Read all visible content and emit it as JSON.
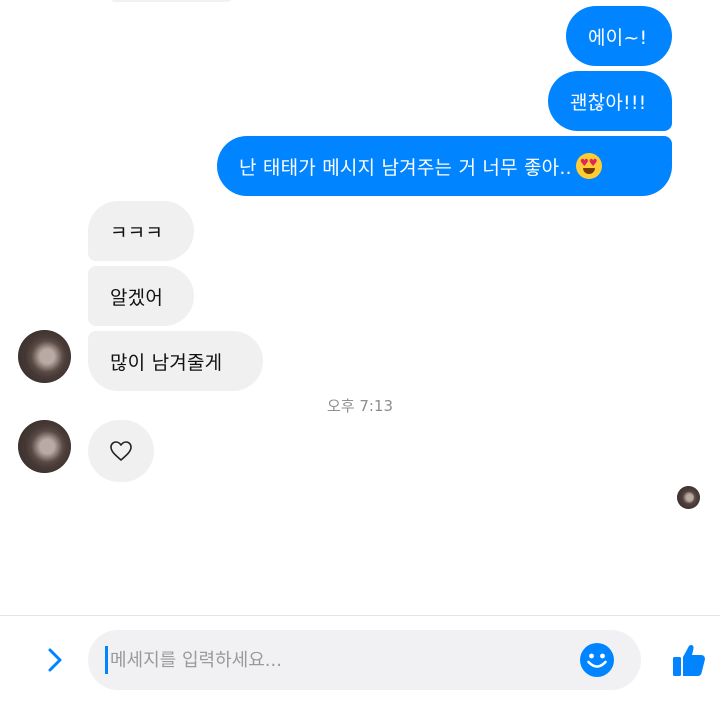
{
  "colors": {
    "accent": "#0084ff",
    "incoming_bubble": "#f1f0f0",
    "timestamp": "#8e8e93"
  },
  "messages": {
    "sent": [
      {
        "text": "에이~!"
      },
      {
        "text": "괜찮아!!!"
      },
      {
        "text": "난 태태가 메시지 남겨주는 거 너무 좋아..",
        "emoji": "heart-eyes-emoji"
      }
    ],
    "received": [
      {
        "text": "ㅋㅋㅋ"
      },
      {
        "text": "알겠어"
      },
      {
        "text": "많이 남겨줄게"
      }
    ],
    "timestamp": "오후 7:13",
    "reaction": "♡"
  },
  "composer": {
    "placeholder": "메세지를 입력하세요...",
    "value": "",
    "expand_icon": "chevron-right-icon",
    "emoji_icon": "smile-icon",
    "like_icon": "thumbs-up-icon"
  }
}
